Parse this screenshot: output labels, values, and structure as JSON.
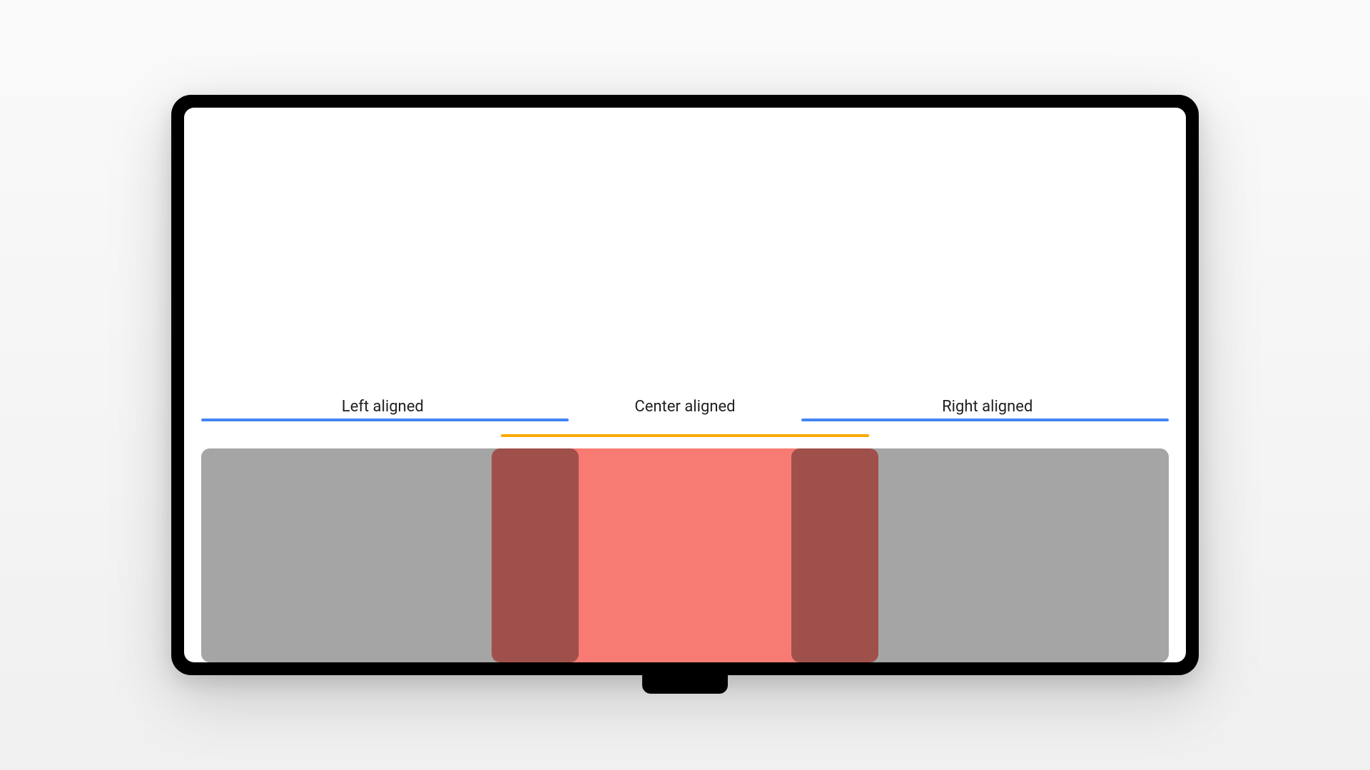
{
  "labels": {
    "left": "Left aligned",
    "center": "Center aligned",
    "right": "Right aligned"
  },
  "colors": {
    "blue_line": "#4285f4",
    "orange_line": "#f9ab00",
    "gray_card": "#a5a5a5",
    "red_card": "rgba(244,67,54,0.7)"
  }
}
